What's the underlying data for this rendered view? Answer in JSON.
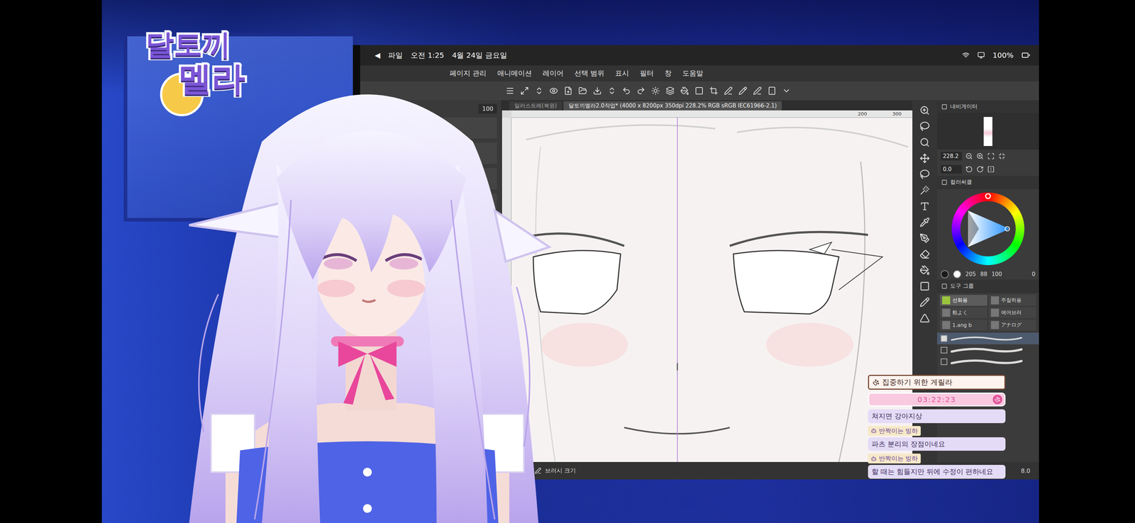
{
  "stream": {
    "logo": {
      "line1": "달토끼",
      "line2": "멜라"
    }
  },
  "app": {
    "status_bar": {
      "back": "◀",
      "app": "파일",
      "time": "오전 1:25",
      "date": "4월 24일 금요일",
      "battery": "100%"
    },
    "menu": [
      "페이지 관리",
      "애니메이션",
      "레이어",
      "선택 범위",
      "표시",
      "필터",
      "창",
      "도움말"
    ],
    "tabs": [
      {
        "label": "일러스트레(복원)",
        "selected": false
      },
      {
        "label": "달토끼멜라2.0작업* (4000 x 8200px 350dpi 228.2% RGB sRGB IEC61966-2.1)",
        "selected": true
      }
    ],
    "ruler": [
      "200",
      "300"
    ],
    "left_panel": {
      "opacity": "100"
    },
    "navigator": {
      "title": "내비게이터",
      "zoom": "228.2",
      "angle": "0.0"
    },
    "color": {
      "title": "컬러써클",
      "values": [
        "205",
        "88",
        "100"
      ],
      "extra": "0"
    },
    "tool_group": {
      "title": "도구 그룹",
      "items": [
        {
          "label": "선화용",
          "selected": true
        },
        {
          "label": "주칠하용",
          "selected": false
        },
        {
          "label": "粗よく",
          "selected": false
        },
        {
          "label": "에어브러",
          "selected": false
        },
        {
          "label": "1.ang b",
          "selected": false
        },
        {
          "label": "アナログ",
          "selected": false
        }
      ]
    },
    "brushes": [
      {
        "selected": true
      },
      {
        "selected": false
      },
      {
        "selected": false
      }
    ],
    "footer": {
      "label": "브러시 크기",
      "value": "8.0"
    }
  },
  "chat": {
    "title": "집중하기 위한 게릴라",
    "timer": "03:22:23",
    "messages": [
      {
        "author": "",
        "text": "쳐지면 강아지상"
      },
      {
        "author": "반짝이는 빙하",
        "text": "파츠 분리의 장점이네요"
      },
      {
        "author": "반짝이는 빙하",
        "text": "할 때는 힘들지만 뒤에 수정이 편하네요"
      }
    ]
  }
}
